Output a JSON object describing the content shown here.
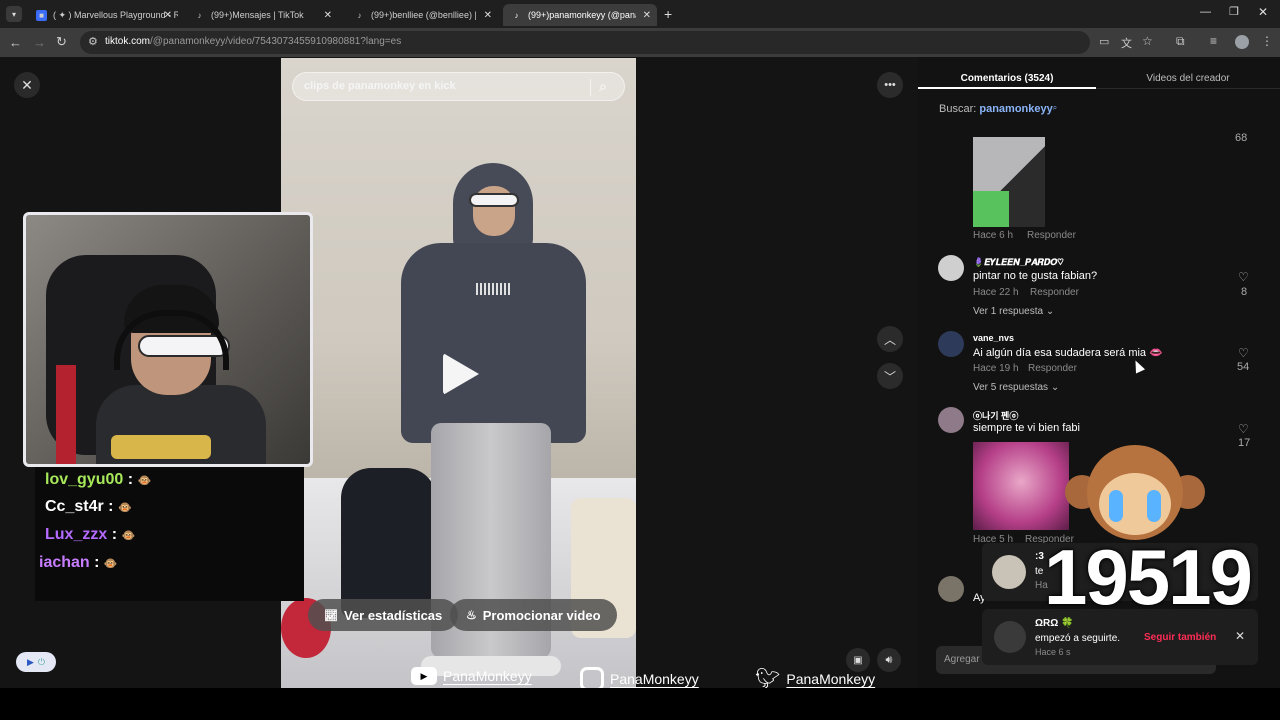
{
  "browser": {
    "tabs": [
      {
        "title": "( ✦ ) Marvellous Playground - R",
        "icon": "roblox-icon"
      },
      {
        "title": "(99+)Mensajes | TikTok",
        "icon": "tiktok-icon"
      },
      {
        "title": "(99+)benlliee (@benlliee) | TikTok",
        "icon": "tiktok-icon"
      },
      {
        "title": "(99+)panamonkeyy (@panamonkeyy)",
        "icon": "tiktok-icon"
      }
    ],
    "url_host": "tiktok.com",
    "url_path": "/@panamonkeyy/video/7543073455910980881?lang=es"
  },
  "video": {
    "search_placeholder": "clips de panamonkey en kick",
    "stats_button": "Ver estadísticas",
    "promote_button": "Promocionar video"
  },
  "stream_overlay": {
    "chat": [
      {
        "user": "lov_gyu00",
        "color": "#a6e85a"
      },
      {
        "user": "Cc_st4r",
        "color": "#ffffff"
      },
      {
        "user": "Lux_zzx",
        "color": "#b56bff"
      },
      {
        "user": "iachan",
        "color": "#c77dff"
      }
    ],
    "viewer_count": "19519"
  },
  "watermarks": {
    "youtube": "PanaMonkeyy",
    "instagram": "PanaMonkeyy",
    "twitter": "PanaMonkeyy"
  },
  "panel": {
    "tab_comments": "Comentarios (3524)",
    "tab_videos": "Videos del creador",
    "search_label": "Buscar:",
    "search_term": "panamonkeyy",
    "comments": [
      {
        "name": "",
        "text": "",
        "time": "Hace 6 h",
        "reply": "Responder",
        "likes": "68",
        "more": ""
      },
      {
        "name": "🪻𝑬𝒀𝑳𝑬𝑬𝑵_𝑷𝑨𝑹𝑫𝑶♡",
        "text": "pintar no te gusta fabian?",
        "time": "Hace 22 h",
        "reply": "Responder",
        "likes": "8",
        "more": "Ver 1 respuesta"
      },
      {
        "name": "vane_nvs",
        "text": "Ai algún día esa sudadera será mia 👄",
        "time": "Hace 19 h",
        "reply": "Responder",
        "likes": "54",
        "more": "Ver 5 respuestas"
      },
      {
        "name": "ⓞ나기 펜ⓞ",
        "text": "siempre te vi bien fabi",
        "time": "Hace 5 h",
        "reply": "Responder",
        "likes": "17",
        "more": ""
      },
      {
        "name": "",
        "text": "Ay",
        "time": "",
        "reply": "",
        "likes": "",
        "more": ""
      }
    ],
    "add_comment_placeholder": "Agregar"
  },
  "notifications": [
    {
      "name": ":3",
      "text": "te",
      "time": "Ha"
    },
    {
      "name": "ΩRΩ 🍀",
      "text": "empezó a seguirte.",
      "time": "Hace 6 s",
      "action": "Seguir también"
    }
  ],
  "colors": {
    "accent": "#fe2c55",
    "link": "#8ab4f8"
  }
}
